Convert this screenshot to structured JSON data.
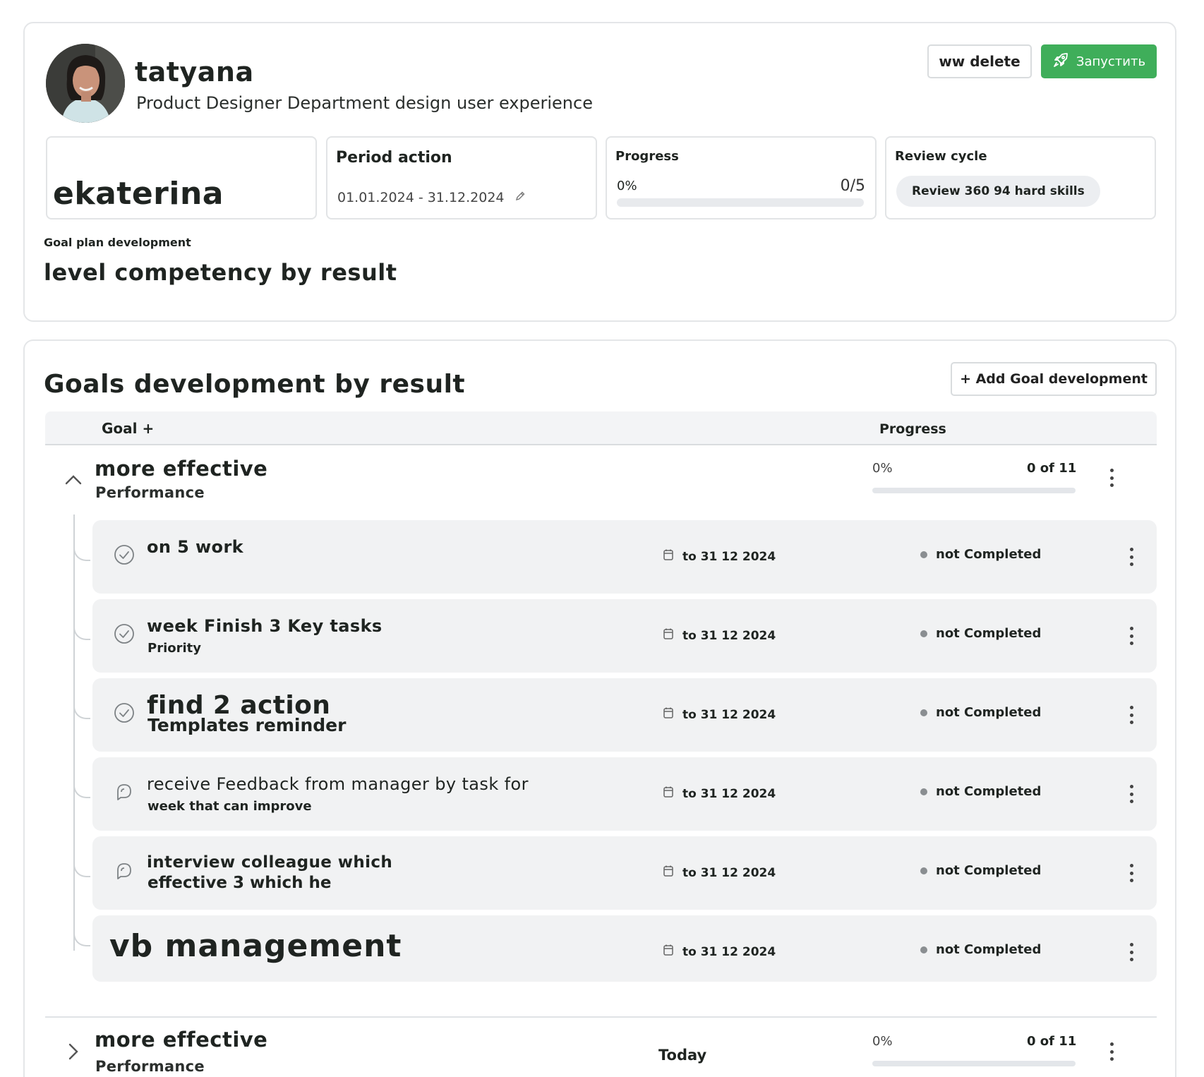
{
  "profile": {
    "name": "tatyana",
    "role": "Product Designer Department design user experience",
    "delete_label": "ww delete",
    "launch_label": "Запустить"
  },
  "stats": {
    "owner": "ekaterina",
    "period_title": "Period action",
    "period_value": "01.01.2024 - 31.12.2024",
    "progress_title": "Progress",
    "progress_pct": "0%",
    "progress_count": "0/5",
    "progress_fraction": 0,
    "review_title": "Review cycle",
    "review_chip": "Review 360 94 hard skills"
  },
  "plan": {
    "label": "Goal plan development",
    "title": "level competency by result"
  },
  "goals": {
    "title": "Goals development by result",
    "add_label": "+ Add Goal development",
    "col_goal": "Goal +",
    "col_progress": "Progress",
    "groups": [
      {
        "title": "more effective",
        "subtitle": "Performance",
        "pct": "0%",
        "count": "0 of 11",
        "fraction": 0,
        "expanded": true,
        "tasks": [
          {
            "title": "on 5 work",
            "subtitle": "",
            "due": "to 31 12 2024",
            "status": "not Completed",
            "icon": "check-circle-icon"
          },
          {
            "title": "week Finish 3 Key tasks",
            "subtitle": "Priority",
            "due": "to 31 12 2024",
            "status": "not Completed",
            "icon": "check-circle-icon"
          },
          {
            "title": "find 2 action",
            "subtitle": "Templates reminder",
            "due": "to 31 12 2024",
            "status": "not Completed",
            "icon": "check-circle-icon"
          },
          {
            "title": "receive Feedback from manager by task for",
            "subtitle": "week that can improve",
            "due": "to 31 12 2024",
            "status": "not Completed",
            "icon": "chat-bubble-icon"
          },
          {
            "title": "interview colleague which",
            "subtitle": "effective 3 which he",
            "due": "to 31 12 2024",
            "status": "not Completed",
            "icon": "chat-bubble-icon"
          },
          {
            "title": "vb management",
            "subtitle": "",
            "due": "to 31 12 2024",
            "status": "not Completed",
            "icon": ""
          }
        ]
      },
      {
        "title": "more effective",
        "subtitle": "Performance",
        "date_label": "Today",
        "pct": "0%",
        "count": "0 of 11",
        "fraction": 0,
        "expanded": false
      }
    ]
  },
  "colors": {
    "accent_green": "#3fae5a",
    "card_border": "#e4e6e8",
    "task_bg": "#f1f2f3"
  }
}
